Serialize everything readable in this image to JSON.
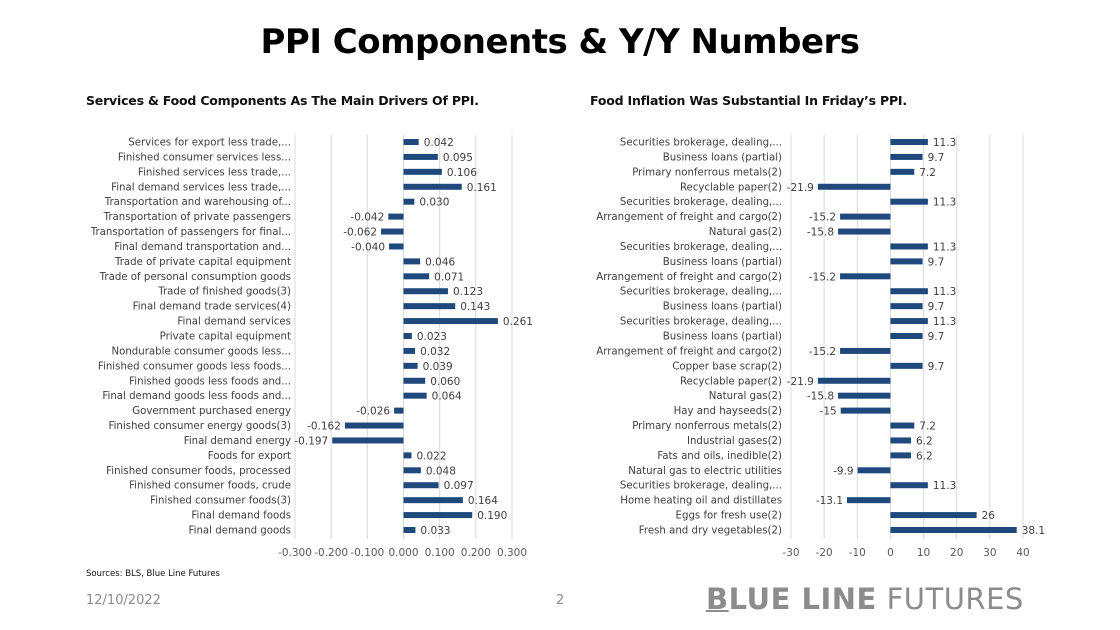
{
  "header": {
    "title": "PPI Components & Y/Y Numbers"
  },
  "colors": {
    "bar": "#1f497d",
    "grid": "#d9d9d9",
    "text": "#404040",
    "brand": "#8c8c8c"
  },
  "chart_data": [
    {
      "type": "bar",
      "orientation": "horizontal",
      "title": "Services & Food Components As The Main Drivers Of PPI.",
      "xlabel": "",
      "ylabel": "",
      "xlim": [
        -0.3,
        0.3
      ],
      "xticks": [
        -0.3,
        -0.2,
        -0.1,
        0.0,
        0.1,
        0.2,
        0.3
      ],
      "xtick_labels": [
        "-0.300",
        "-0.200",
        "-0.100",
        "0.000",
        "0.100",
        "0.200",
        "0.300"
      ],
      "value_format_decimals": 3,
      "grid": true,
      "categories": [
        "Services for export less trade,...",
        "Finished consumer services less...",
        "Finished services less trade,...",
        "Final demand services less trade,...",
        "Transportation and warehousing of...",
        "Transportation of private passengers",
        "Transportation of passengers for final...",
        "Final demand transportation and...",
        "Trade of private capital equipment",
        "Trade of personal consumption goods",
        "Trade of finished goods(3)",
        "Final demand trade services(4)",
        "Final demand services",
        "Private capital equipment",
        "Nondurable consumer goods less...",
        "Finished consumer goods less foods...",
        "Finished goods less foods and...",
        "Final demand goods less foods and...",
        "Government purchased energy",
        "Finished consumer energy goods(3)",
        "Final demand energy",
        "Foods for export",
        "Finished consumer foods, processed",
        "Finished consumer foods, crude",
        "Finished consumer foods(3)",
        "Final demand foods",
        "Final demand goods"
      ],
      "values": [
        0.042,
        0.095,
        0.106,
        0.161,
        0.03,
        -0.042,
        -0.062,
        -0.04,
        0.046,
        0.071,
        0.123,
        0.143,
        0.261,
        0.023,
        0.032,
        0.039,
        0.06,
        0.064,
        -0.026,
        -0.162,
        -0.197,
        0.022,
        0.048,
        0.097,
        0.164,
        0.19,
        0.033
      ]
    },
    {
      "type": "bar",
      "orientation": "horizontal",
      "title": "Food Inflation Was Substantial In Friday’s PPI.",
      "xlabel": "",
      "ylabel": "",
      "xlim": [
        -30,
        40
      ],
      "xticks": [
        -30,
        -20,
        -10,
        0,
        10,
        20,
        30,
        40
      ],
      "xtick_labels": [
        "-30",
        "-20",
        "-10",
        "0",
        "10",
        "20",
        "30",
        "40"
      ],
      "value_format_decimals": null,
      "grid": true,
      "categories": [
        "Securities brokerage, dealing,...",
        "Business loans (partial)",
        "Primary nonferrous metals(2)",
        "Recyclable paper(2)",
        "Securities brokerage, dealing,...",
        "Arrangement of freight and cargo(2)",
        "Natural gas(2)",
        "Securities brokerage, dealing,...",
        "Business loans (partial)",
        "Arrangement of freight and cargo(2)",
        "Securities brokerage, dealing,...",
        "Business loans (partial)",
        "Securities brokerage, dealing,...",
        "Business loans (partial)",
        "Arrangement of freight and cargo(2)",
        "Copper base scrap(2)",
        "Recyclable paper(2)",
        "Natural gas(2)",
        "Hay and hayseeds(2)",
        "Primary nonferrous metals(2)",
        "Industrial gases(2)",
        "Fats and oils, inedible(2)",
        "Natural gas to electric utilities",
        "Securities brokerage, dealing,...",
        "Home heating oil and distillates",
        "Eggs for fresh use(2)",
        "Fresh and dry vegetables(2)"
      ],
      "values": [
        11.3,
        9.7,
        7.2,
        -21.9,
        11.3,
        -15.2,
        -15.8,
        11.3,
        9.7,
        -15.2,
        11.3,
        9.7,
        11.3,
        9.7,
        -15.2,
        9.7,
        -21.9,
        -15.8,
        -15,
        7.2,
        6.2,
        6.2,
        -9.9,
        11.3,
        -13.1,
        26,
        38.1
      ]
    }
  ],
  "footer": {
    "source": "Sources: BLS, Blue Line Futures",
    "date": "12/10/2022",
    "page_number": "2",
    "brand_bold_first": "B",
    "brand_bold_rest": "LUE LINE",
    "brand_light": " FUTURES"
  }
}
